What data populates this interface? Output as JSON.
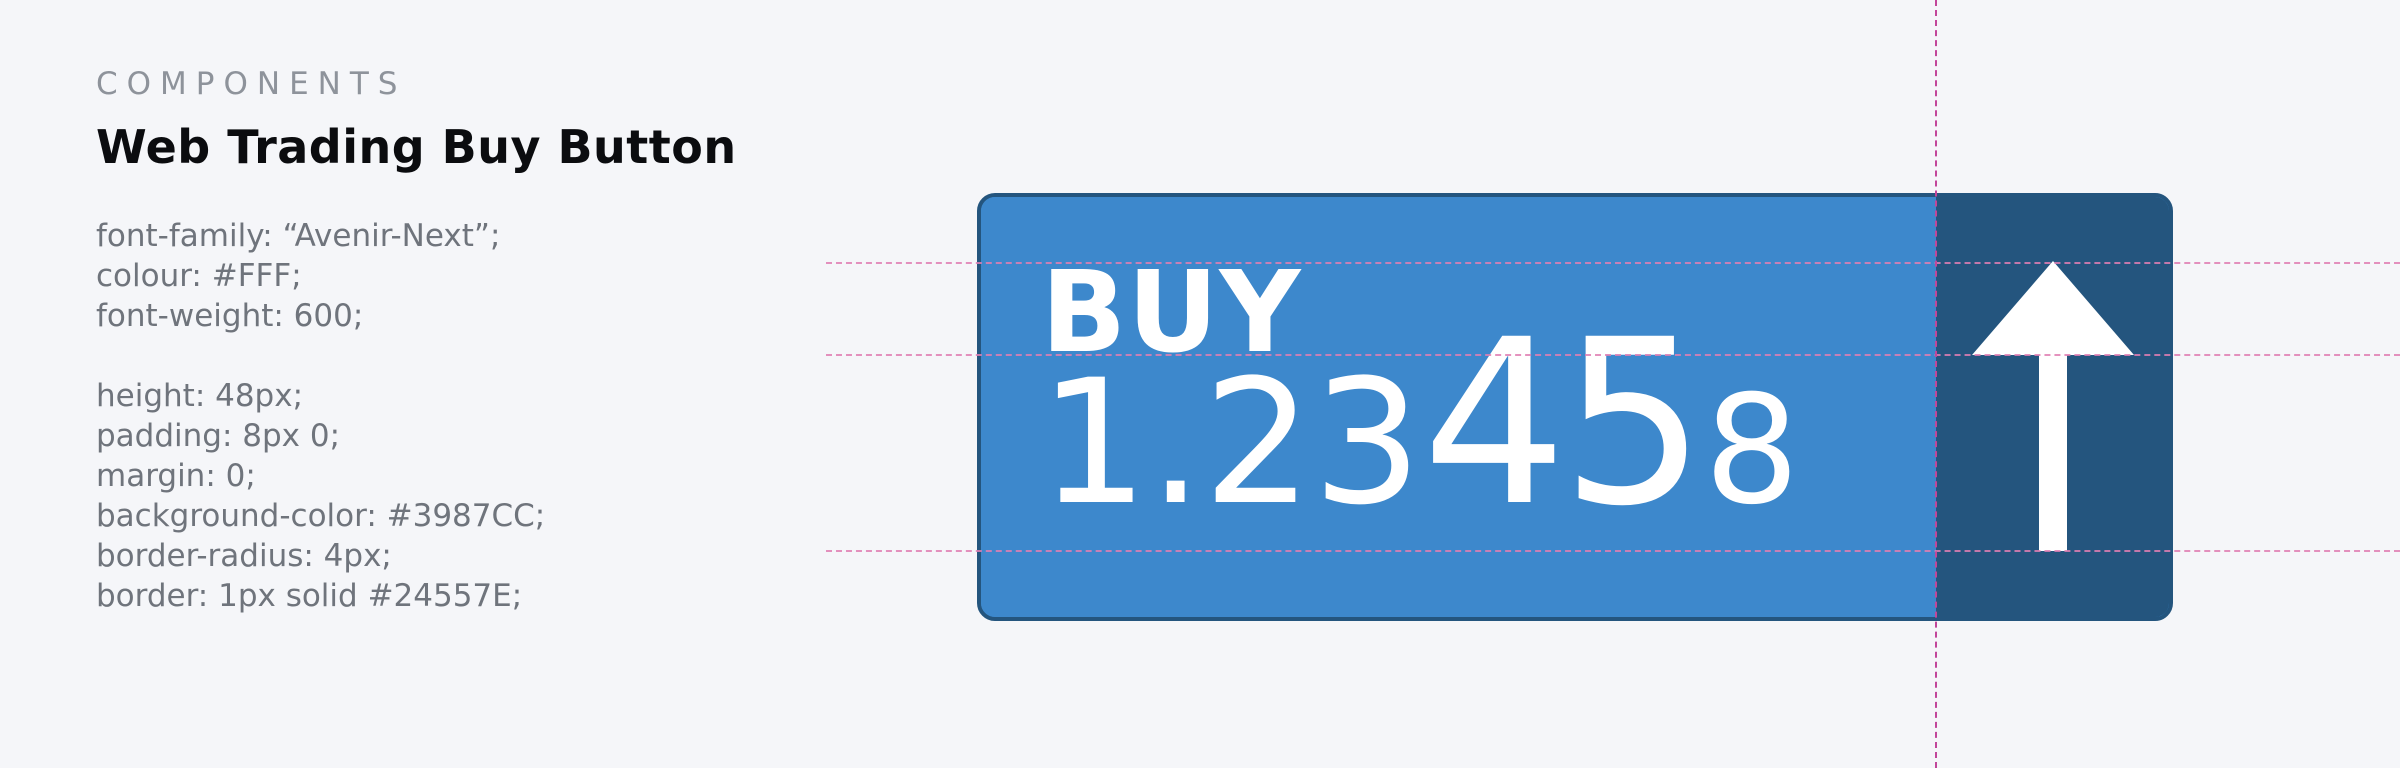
{
  "header": {
    "eyebrow": "COMPONENTS",
    "title": "Web Trading Buy Button"
  },
  "spec": {
    "lines_group1": [
      "font-family: “Avenir-Next”;",
      "colour: #FFF;",
      "font-weight: 600;"
    ],
    "lines_group2": [
      "height: 48px;",
      "padding: 8px 0;",
      "margin: 0;",
      "background-color: #3987CC;",
      "border-radius: 4px;",
      "border: 1px solid #24557E;"
    ]
  },
  "button": {
    "label": "BUY",
    "price_prefix": "1.23",
    "price_big": "45",
    "price_pip": "8",
    "icon": "arrow-up-icon",
    "colors": {
      "background": "#3987CC",
      "border": "#24557E",
      "text": "#FFFFFF"
    }
  },
  "guides": {
    "color": "#E17FB3"
  }
}
